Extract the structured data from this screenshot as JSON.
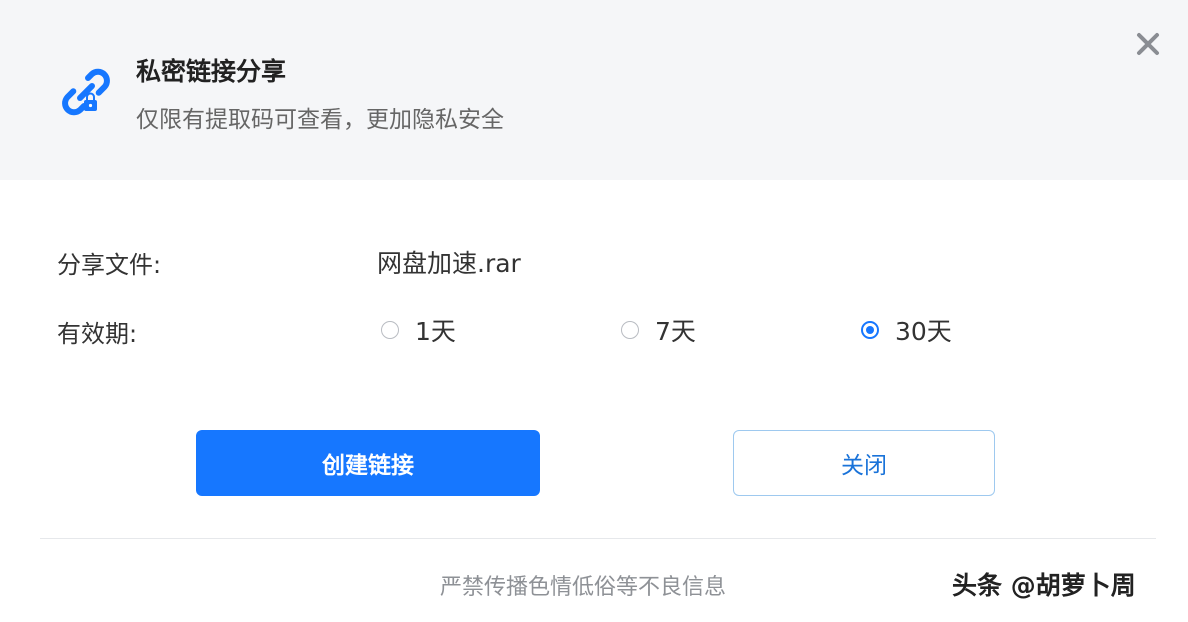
{
  "header": {
    "title": "私密链接分享",
    "subtitle": "仅限有提取码可查看，更加隐私安全",
    "icon": "link-lock-icon",
    "accent_color": "#1677ff"
  },
  "form": {
    "share_file_label": "分享文件:",
    "share_file_value": "网盘加速.rar",
    "validity_label": "有效期:",
    "validity_options": [
      {
        "label": "1天",
        "selected": false
      },
      {
        "label": "7天",
        "selected": false
      },
      {
        "label": "30天",
        "selected": true
      }
    ]
  },
  "buttons": {
    "create": "创建链接",
    "close": "关闭"
  },
  "footer": {
    "notice": "严禁传播色情低俗等不良信息"
  },
  "watermark": "头条 @胡萝卜周"
}
